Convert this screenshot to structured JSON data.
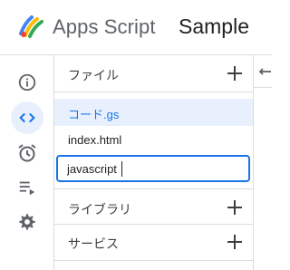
{
  "header": {
    "app_title": "Apps Script",
    "project_title": "Sample"
  },
  "rail": {
    "items": [
      {
        "icon": "info-icon",
        "active": false
      },
      {
        "icon": "code-icon",
        "active": true
      },
      {
        "icon": "alarm-clock-icon",
        "active": false
      },
      {
        "icon": "executions-icon",
        "active": false
      },
      {
        "icon": "gear-icon",
        "active": false
      }
    ]
  },
  "files": {
    "header_label": "ファイル",
    "items": [
      {
        "name": "コード.gs",
        "selected": true
      },
      {
        "name": "index.html",
        "selected": false
      }
    ],
    "rename_value": "javascript"
  },
  "libraries": {
    "label": "ライブラリ"
  },
  "services": {
    "label": "サービス"
  },
  "colors": {
    "accent": "#1a73e8",
    "selected_bg": "#e8f0fe",
    "divider": "#dadce0",
    "icon": "#5f6368"
  }
}
